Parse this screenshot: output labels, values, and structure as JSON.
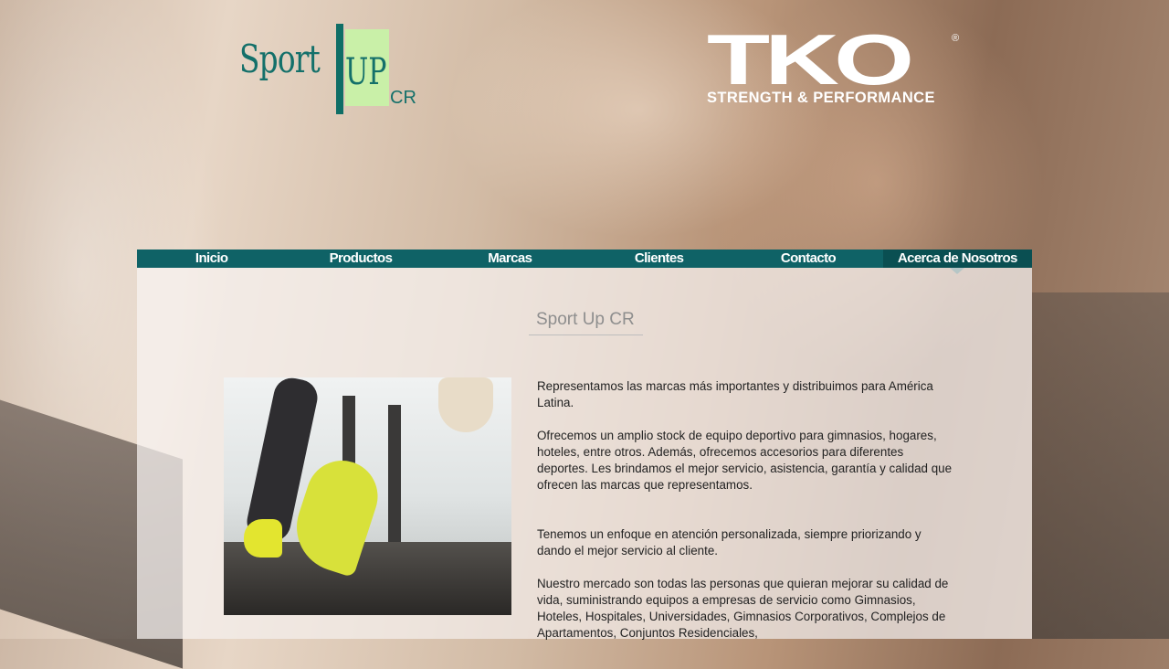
{
  "header": {
    "logo_left": {
      "sport": "Sport",
      "up": "UP",
      "cr": "CR"
    },
    "logo_right": {
      "tko": "TKO",
      "reg": "®",
      "tagline": "STRENGTH & PERFORMANCE"
    }
  },
  "nav": {
    "items": [
      {
        "label": "Inicio"
      },
      {
        "label": "Productos"
      },
      {
        "label": "Marcas"
      },
      {
        "label": "Clientes"
      },
      {
        "label": "Contacto"
      },
      {
        "label": "Acerca de Nosotros"
      }
    ],
    "active_index": 5
  },
  "main": {
    "title": "Sport Up CR",
    "paragraphs": [
      "Representamos las marcas más importantes y distribuimos para América Latina.",
      "Ofrecemos un amplio stock de equipo deportivo para gimnasios, hogares, hoteles, entre otros. Además, ofrecemos accesorios para diferentes deportes. Les brindamos el mejor servicio, asistencia, garantía y  calidad que ofrecen las marcas que representamos.",
      "Tenemos un enfoque en atención personalizada, siempre priorizando y dando el mejor servicio al cliente.",
      "Nuestro mercado son todas las personas que quieran mejorar su calidad de vida, suministrando equipos  a empresas de servicio como Gimnasios, Hoteles, Hospitales, Universidades, Gimnasios Corporativos, Complejos de Apartamentos, Conjuntos Residenciales,"
    ]
  },
  "colors": {
    "nav_bg": "#0f6266",
    "nav_active": "#0a4f52",
    "brand_teal": "#14706a",
    "logo_green": "#c9f0a8"
  }
}
